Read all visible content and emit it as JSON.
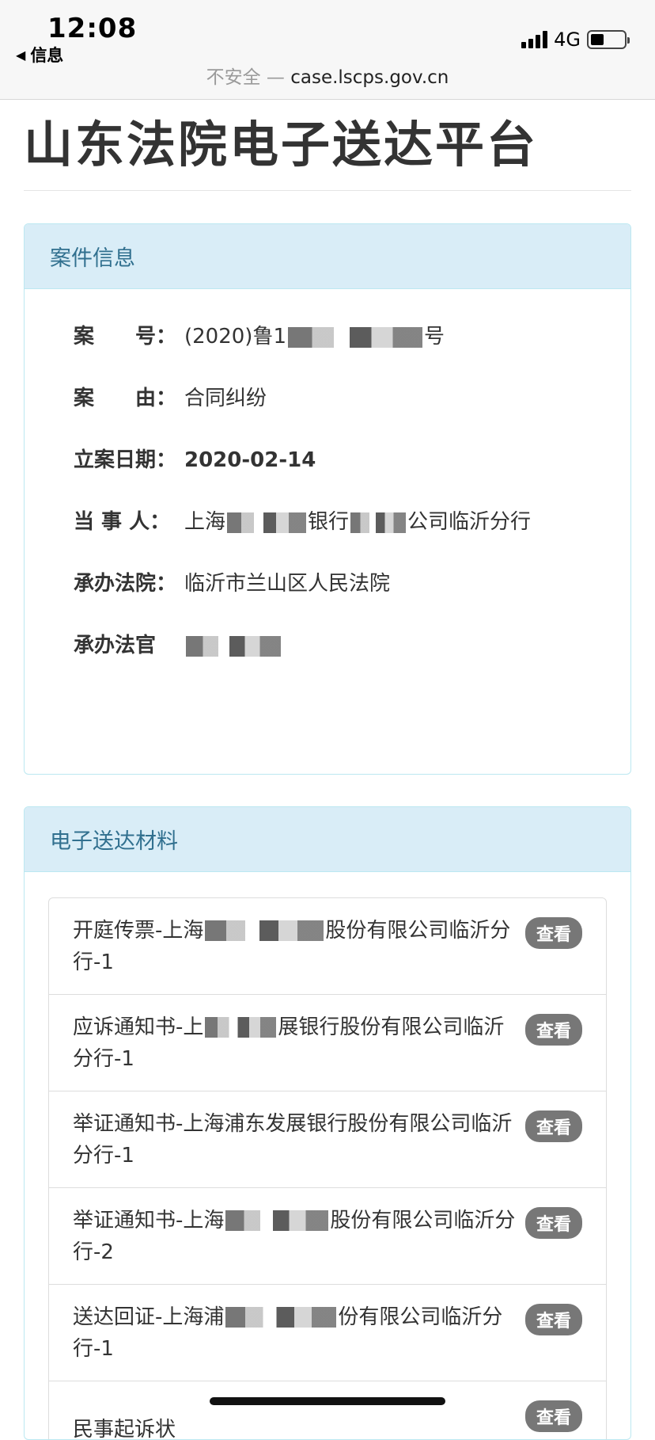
{
  "status_bar": {
    "time": "12:08",
    "back_app": "信息",
    "network": "4G",
    "battery_level": 0.4,
    "signal_bars": 4
  },
  "url_bar": {
    "insecure_label": "不安全 —",
    "url": "case.lscps.gov.cn"
  },
  "page": {
    "title": "山东法院电子送达平台"
  },
  "case_info": {
    "heading": "案件信息",
    "rows": [
      {
        "label": "案　　号：",
        "value": "(2020)鲁1",
        "value_suffix": "号"
      },
      {
        "label": "案　　由：",
        "value": "合同纠纷"
      },
      {
        "label": "立案日期：",
        "value": "2020-02-14"
      },
      {
        "label": "当 事 人：",
        "value": "上海",
        "value_middle": "银行",
        "value_suffix": "公司临沂分行"
      },
      {
        "label": "承办法院：",
        "value": "临沂市兰山区人民法院"
      },
      {
        "label": "承办法官",
        "value": ""
      }
    ]
  },
  "materials": {
    "heading": "电子送达材料",
    "view_label": "查看",
    "items": [
      {
        "prefix": "开庭传票-上海",
        "suffix": "股份有限公司临沂分行-1"
      },
      {
        "prefix": "应诉通知书-上",
        "suffix": "展银行股份有限公司临沂分行-1"
      },
      {
        "prefix": "举证通知书-上海浦东发展银行股份有限公司临沂分行-1",
        "suffix": ""
      },
      {
        "prefix": "举证通知书-上海",
        "suffix": "股份有限公司临沂分行-2"
      },
      {
        "prefix": "送达回证-上海浦",
        "suffix": "份有限公司临沂分行-1"
      },
      {
        "prefix": "民事起诉状",
        "suffix": ""
      }
    ]
  }
}
